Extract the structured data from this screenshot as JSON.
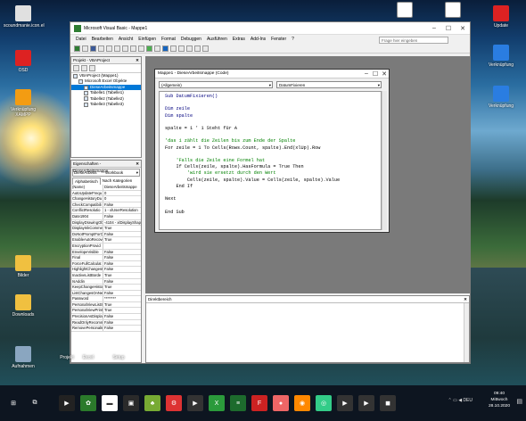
{
  "desktop": {
    "icons_left": [
      {
        "label": "scoundmanie.icon.el",
        "color": "#e0e0e0"
      },
      {
        "label": "OSD",
        "color": "#d22"
      },
      {
        "label": "Verknüpfung XAMPP",
        "color": "#f39c12"
      },
      {
        "label": "Bilder",
        "color": "#f0c040"
      },
      {
        "label": "Downloads",
        "color": "#f0c040"
      },
      {
        "label": "Aufnahmen",
        "color": "#8aa6c0"
      }
    ],
    "icons_top": [
      {
        "label": "",
        "color": "#fff"
      },
      {
        "label": "",
        "color": "#fff"
      }
    ],
    "icons_right": [
      {
        "label": "Update",
        "color": "#d22"
      },
      {
        "label": "Verknüpfung",
        "color": "#2a7de1"
      },
      {
        "label": "Verknüpfung",
        "color": "#2a7de1"
      }
    ],
    "bottom_labels": [
      "Projekt",
      "Excel",
      "Setup"
    ]
  },
  "window": {
    "title": "Microsoft Visual Basic - Mappe1",
    "menu": [
      "Datei",
      "Bearbeiten",
      "Ansicht",
      "Einfügen",
      "Format",
      "Debuggen",
      "Ausführen",
      "Extras",
      "Add-Ins",
      "Fenster",
      "?"
    ],
    "help_placeholder": "Frage hier eingeben",
    "project_panel": {
      "title": "Projekt - VBAProject",
      "tree": [
        {
          "text": "VBAProject (Mappe1)",
          "indent": 0,
          "selected": false
        },
        {
          "text": "Microsoft Excel Objekte",
          "indent": 1,
          "selected": false
        },
        {
          "text": "DieseArbeitsmappe",
          "indent": 2,
          "selected": true
        },
        {
          "text": "Tabelle1 (Tabelle1)",
          "indent": 2,
          "selected": false
        },
        {
          "text": "Tabelle2 (Tabelle2)",
          "indent": 2,
          "selected": false
        },
        {
          "text": "Tabelle3 (Tabelle3)",
          "indent": 2,
          "selected": false
        }
      ]
    },
    "props_panel": {
      "title": "Eigenschaften - DieseArbeitsmappe",
      "object": "DieseArbeits",
      "object_type": "Workbook",
      "tab_alpha": "Alphabetisch",
      "tab_cat": "Nach Kategorien",
      "rows": [
        [
          "(Name)",
          "DieseArbeitsmappe"
        ],
        [
          "AutoUpdateFrequ",
          "0"
        ],
        [
          "ChangeHistoryDu",
          "0"
        ],
        [
          "CheckCompatibili",
          "False"
        ],
        [
          "ConflictResolutio",
          "1 - xlUserResolution"
        ],
        [
          "Date1904",
          "False"
        ],
        [
          "DisplayDrawingOb",
          "-4104 - xlDisplayShapes"
        ],
        [
          "DisplayInkComme",
          "True"
        ],
        [
          "DoNotPromptForC",
          "False"
        ],
        [
          "EnableAutoRecove",
          "True"
        ],
        [
          "EncryptionProvid",
          ""
        ],
        [
          "EnvelopeVisible",
          "False"
        ],
        [
          "Final",
          "False"
        ],
        [
          "ForceFullCalculat",
          "False"
        ],
        [
          "HighlightChangesC",
          "False"
        ],
        [
          "InactiveListBorde",
          "True"
        ],
        [
          "IsAddin",
          "False"
        ],
        [
          "KeepChangeHistor",
          "True"
        ],
        [
          "ListChangesOnNe",
          "False"
        ],
        [
          "Password",
          "********"
        ],
        [
          "PersonalViewListS",
          "True"
        ],
        [
          "PersonalViewPrint",
          "True"
        ],
        [
          "PrecisionAsDispla",
          "False"
        ],
        [
          "ReadOnlyRecomm",
          "False"
        ],
        [
          "RemovePersonalIn",
          "False"
        ]
      ]
    },
    "code_window": {
      "title": "Mappe1 - DieseArbeitsmappe (Code)",
      "object_combo": "(Allgemein)",
      "proc_combo": "DatumFixieren",
      "lines": [
        {
          "t": "Sub DatumFixieren()",
          "c": "kw"
        },
        {
          "t": "",
          "c": ""
        },
        {
          "t": "Dim zeile",
          "c": "kw"
        },
        {
          "t": "Dim spalte",
          "c": "kw"
        },
        {
          "t": "",
          "c": ""
        },
        {
          "t": "spalte = 1 ' 1 Steht für A",
          "c": ""
        },
        {
          "t": "",
          "c": ""
        },
        {
          "t": "'das i zählt die Zeilen bis zum Ende der Spalte",
          "c": "cm"
        },
        {
          "t": "For zeile = 1 To Cells(Rows.Count, spalte).End(xlUp).Row",
          "c": ""
        },
        {
          "t": "",
          "c": ""
        },
        {
          "t": "    'Falls die Zeile eine Formel hat",
          "c": "cm"
        },
        {
          "t": "    If Cells(zeile, spalte).HasFormula = True Then",
          "c": ""
        },
        {
          "t": "        'wird sie ersetzt durch den Wert",
          "c": "cm"
        },
        {
          "t": "        Cells(zeile, spalte).Value = Cells(zeile, spalte).Value",
          "c": ""
        },
        {
          "t": "    End If",
          "c": ""
        },
        {
          "t": "",
          "c": ""
        },
        {
          "t": "Next",
          "c": ""
        },
        {
          "t": "",
          "c": ""
        },
        {
          "t": "End Sub",
          "c": ""
        }
      ]
    },
    "immediate": {
      "title": "Direktbereich"
    }
  },
  "taskbar": {
    "apps": [
      {
        "name": "cmd",
        "color": "#222",
        "glyph": "▶"
      },
      {
        "name": "app",
        "color": "#2b7a2b",
        "glyph": "✿"
      },
      {
        "name": "app",
        "color": "#fff",
        "glyph": "▬"
      },
      {
        "name": "app",
        "color": "#2a2a2a",
        "glyph": "▣"
      },
      {
        "name": "app",
        "color": "#7a3",
        "glyph": "♣"
      },
      {
        "name": "app",
        "color": "#d33",
        "glyph": "⚙"
      },
      {
        "name": "app",
        "color": "#333",
        "glyph": "▶"
      },
      {
        "name": "app",
        "color": "#2b9a3b",
        "glyph": "X"
      },
      {
        "name": "app",
        "color": "#1d6b2d",
        "glyph": "≡"
      },
      {
        "name": "app",
        "color": "#c22",
        "glyph": "F"
      },
      {
        "name": "app",
        "color": "#e66",
        "glyph": "●"
      },
      {
        "name": "app",
        "color": "#f80",
        "glyph": "◉"
      },
      {
        "name": "app",
        "color": "#3c8",
        "glyph": "◎"
      },
      {
        "name": "app",
        "color": "#333",
        "glyph": "▶"
      },
      {
        "name": "app",
        "color": "#333",
        "glyph": "▶"
      },
      {
        "name": "app",
        "color": "#333",
        "glyph": "◼"
      }
    ],
    "lang": "DEU",
    "time": "09:40",
    "day": "Mittwoch",
    "date": "28.10.2020"
  }
}
